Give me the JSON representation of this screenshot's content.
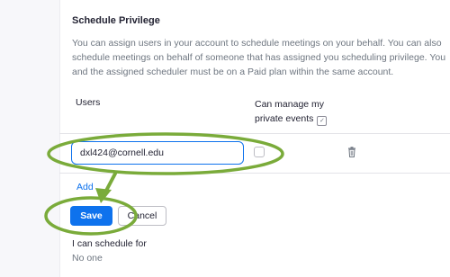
{
  "schedule_privilege": {
    "title": "Schedule Privilege",
    "description": "You can assign users in your account to schedule meetings on your behalf. You can also schedule meetings on behalf of someone that has assigned you scheduling privilege. You and the assigned scheduler must be on a Paid plan within the same account.",
    "table": {
      "headers": {
        "users": "Users",
        "manage_private": "Can manage my private events"
      },
      "rows": [
        {
          "user_email": "dxl424@cornell.edu",
          "manage_private_checked": false
        }
      ]
    },
    "add_label": "Add",
    "save_label": "Save",
    "cancel_label": "Cancel",
    "can_schedule_for": {
      "label": "I can schedule for",
      "value": "No one"
    }
  },
  "icons": {
    "manage_private_info": "calendar-icon",
    "row_delete": "trash-icon"
  },
  "colors": {
    "primary_button": "#0e72ed",
    "link": "#0e72ed",
    "annotation_highlight": "#7aab3a"
  }
}
